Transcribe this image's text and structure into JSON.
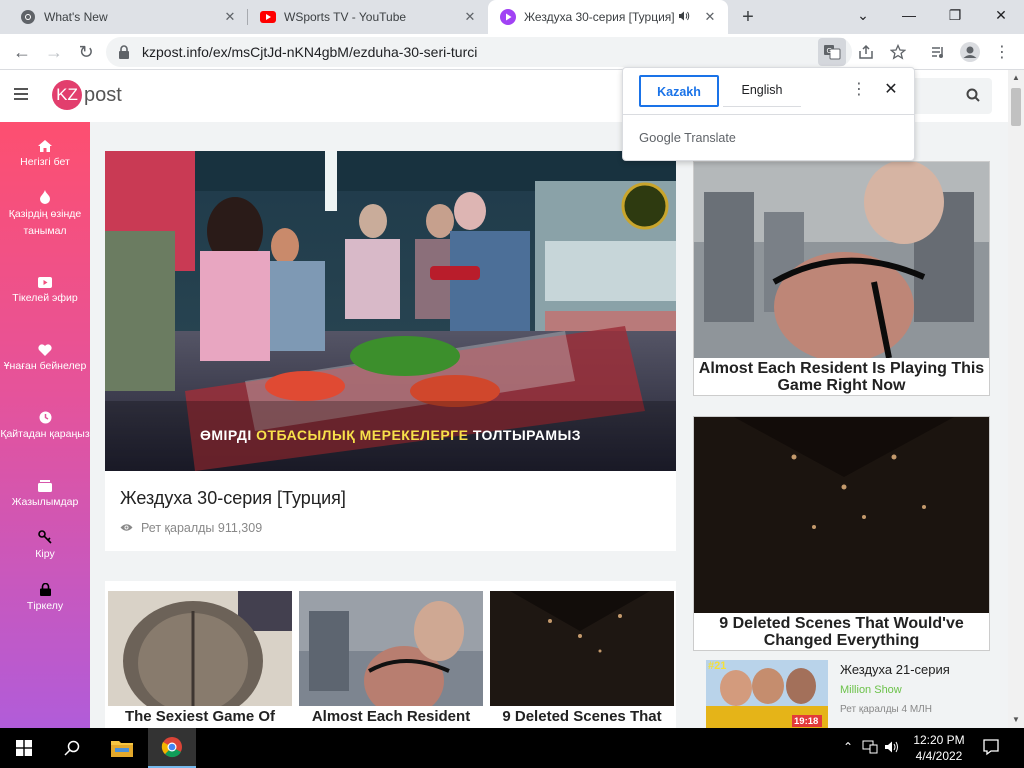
{
  "browser": {
    "tabs": [
      {
        "title": "What's New",
        "active": false
      },
      {
        "title": "WSports TV - YouTube",
        "active": false
      },
      {
        "title": "Жездуха 30-серия [Турция]",
        "active": true
      }
    ],
    "new_tab": "+",
    "url": "kzpost.info/ex/msCjtJd-nKN4gbM/ezduha-30-seri-turci"
  },
  "translate_popup": {
    "lang_source": "Kazakh",
    "lang_target": "English",
    "brand_google": "Google",
    "brand_translate": "Translate"
  },
  "site": {
    "logo_kz": "KZ",
    "logo_post": "post"
  },
  "sidebar": {
    "items": [
      {
        "label": "Негізгі бет",
        "icon": "home-icon"
      },
      {
        "label": "Қазірдің өзінде танымал",
        "icon": "fire-icon"
      },
      {
        "label": "Тікелей эфир",
        "icon": "live-icon"
      },
      {
        "label": "Ұнаған бейнелер",
        "icon": "heart-icon"
      },
      {
        "label": "Қайтадан қараңыз",
        "icon": "history-icon"
      },
      {
        "label": "Жазылымдар",
        "icon": "subscriptions-icon"
      },
      {
        "label": "Кіру",
        "icon": "key-icon"
      },
      {
        "label": "Тіркелу",
        "icon": "lock-icon"
      }
    ]
  },
  "video": {
    "caption_part1": "ӨМІРДІ ",
    "caption_highlight": "ОТБАСЫЛЫҚ МЕРЕКЕЛЕРГЕ",
    "caption_part2": " ТОЛТЫРАМЫЗ",
    "title": "Жездуха 30-серия [Турция]",
    "views": "Рет қаралды 911,309"
  },
  "grid": {
    "items": [
      {
        "caption": "The Sexiest Game Of"
      },
      {
        "caption": "Almost Each Resident"
      },
      {
        "caption": "9 Deleted Scenes That"
      }
    ]
  },
  "ads": [
    {
      "caption": "Almost Each Resident Is Playing This Game Right Now"
    },
    {
      "caption": "9 Deleted Scenes That Would've Changed Everything"
    }
  ],
  "related": {
    "badge": "#21",
    "duration": "19:18",
    "title": "Жездуха 21-серия",
    "channel": "Million Show",
    "views": "Рет қаралды 4 МЛН"
  },
  "taskbar": {
    "time": "12:20 PM",
    "date": "4/4/2022"
  },
  "colors": {
    "sidebar_top": "#fd4f70",
    "sidebar_bottom": "#b15cd9",
    "accent_blue": "#1a73e8",
    "channel_green": "#6cc24a"
  }
}
